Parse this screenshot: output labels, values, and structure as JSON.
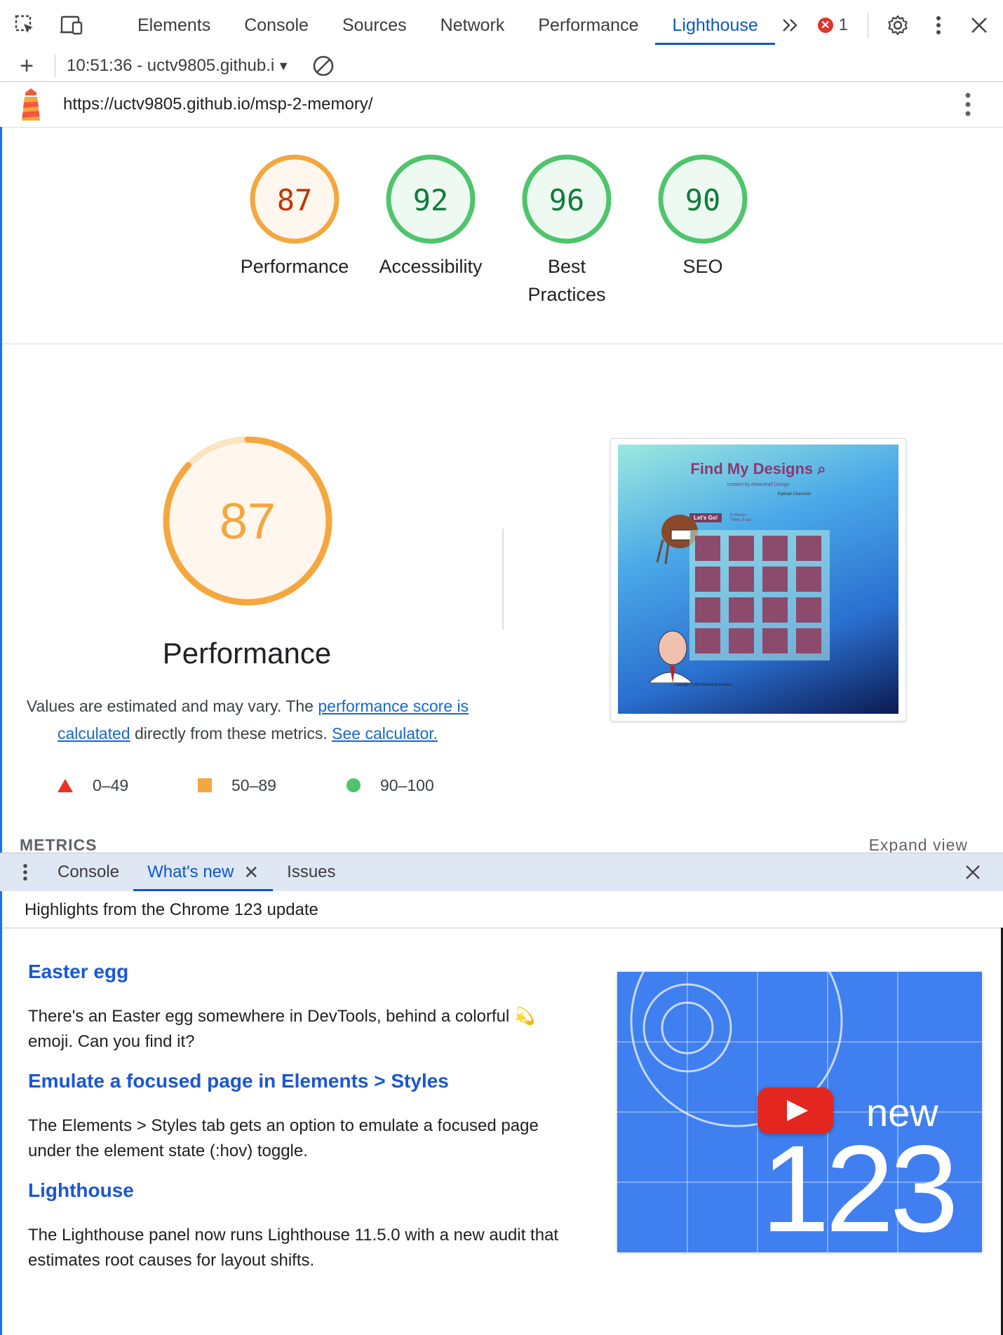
{
  "devtools": {
    "tabs": [
      {
        "label": "Elements"
      },
      {
        "label": "Console"
      },
      {
        "label": "Sources"
      },
      {
        "label": "Network"
      },
      {
        "label": "Performance"
      },
      {
        "label": "Lighthouse",
        "active": true
      }
    ],
    "error_count": "1",
    "more_tabs_glyph": ">>"
  },
  "lighthouse_toolbar": {
    "report_selector": "10:51:36 - uctv9805.github.i"
  },
  "report": {
    "url": "https://uctv9805.github.io/msp-2-memory/",
    "categories": [
      {
        "name": "Performance",
        "score": 87,
        "rating": "average"
      },
      {
        "name": "Accessibility",
        "score": 92,
        "rating": "pass"
      },
      {
        "name": "Best Practices",
        "score": 96,
        "rating": "pass"
      },
      {
        "name": "SEO",
        "score": 90,
        "rating": "pass"
      }
    ],
    "performance": {
      "score": "87",
      "title": "Performance",
      "desc_prefix": "Values are estimated and may vary. The ",
      "desc_link1": "performance score is calculated",
      "desc_mid": " directly from these metrics. ",
      "desc_link2": "See calculator."
    },
    "legend": [
      {
        "range": "0–49",
        "shape": "triangle",
        "color": "#eb3223"
      },
      {
        "range": "50–89",
        "shape": "square",
        "color": "#f4a73d"
      },
      {
        "range": "90–100",
        "shape": "circle",
        "color": "#4ec56a"
      }
    ],
    "metrics_heading": "METRICS",
    "expand_view": "Expand view",
    "screenshot": {
      "title": "Find My Designs",
      "subtitle": "created by AMarshall Design",
      "alt_text": "Eyeball Character",
      "button": "Let's Go!",
      "moves": "0 moves",
      "time": "Time: 0 sec",
      "footer": "Copyright © 2024 AMarshall Designs"
    }
  },
  "drawer": {
    "tabs": [
      {
        "label": "Console"
      },
      {
        "label": "What's new",
        "active": true,
        "closable": true
      },
      {
        "label": "Issues"
      }
    ],
    "header": "Highlights from the Chrome 123 update",
    "items": [
      {
        "title": "Easter egg",
        "body": "There's an Easter egg somewhere in DevTools, behind a colorful 💫 emoji. Can you find it?"
      },
      {
        "title": "Emulate a focused page in Elements > Styles",
        "body": "The Elements > Styles tab gets an option to emulate a focused page under the element state (:hov) toggle."
      },
      {
        "title": "Lighthouse",
        "body": "The Lighthouse panel now runs Lighthouse 11.5.0 with a new audit that estimates root causes for layout shifts."
      }
    ],
    "video": {
      "label_new": "new",
      "label_version": "123"
    }
  },
  "colors": {
    "accent": "#0b57d0",
    "pass": "#0c7d3a",
    "average": "#c33300",
    "average_ring": "#f4a73d",
    "pass_ring": "#4ec56a"
  }
}
